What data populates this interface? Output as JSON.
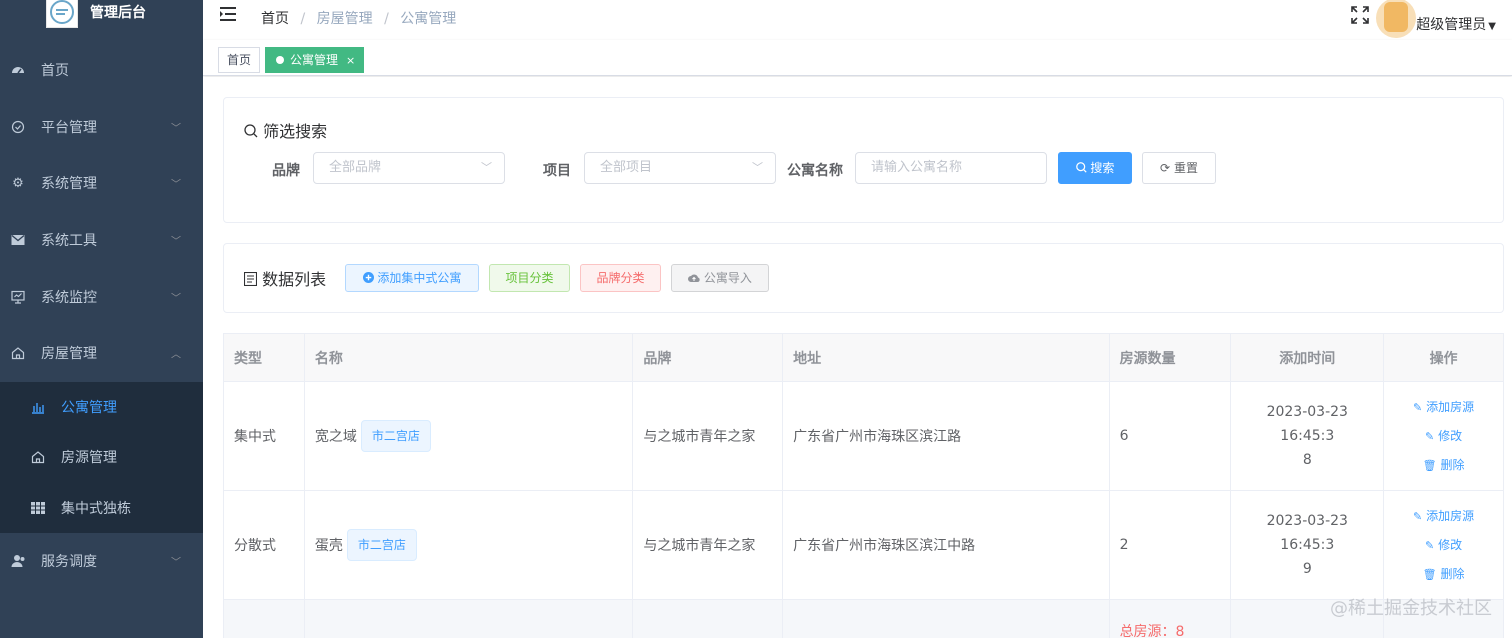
{
  "sidebar": {
    "title": "管理后台",
    "items": [
      {
        "label": "首页",
        "icon": "dashboard-icon"
      },
      {
        "label": "平台管理",
        "icon": "platform-icon"
      },
      {
        "label": "系统管理",
        "icon": "gear-icon"
      },
      {
        "label": "系统工具",
        "icon": "mail-icon"
      },
      {
        "label": "系统监控",
        "icon": "monitor-icon"
      },
      {
        "label": "房屋管理",
        "icon": "house-icon"
      },
      {
        "label": "服务调度",
        "icon": "user-icon"
      }
    ],
    "sub_items": [
      {
        "label": "公寓管理",
        "icon": "chart-icon"
      },
      {
        "label": "房源管理",
        "icon": "home-icon"
      },
      {
        "label": "集中式独栋",
        "icon": "grid-icon"
      }
    ]
  },
  "navbar": {
    "breadcrumb": [
      "首页",
      "房屋管理",
      "公寓管理"
    ],
    "separator": "/",
    "user_name": "超级管理员"
  },
  "tags": {
    "first": "首页",
    "active": "公寓管理",
    "close": "×"
  },
  "filter": {
    "title": "筛选搜索",
    "brand_label": "品牌",
    "brand_placeholder": "全部品牌",
    "project_label": "项目",
    "project_placeholder": "全部项目",
    "name_label": "公寓名称",
    "name_placeholder": "请输入公寓名称",
    "search_btn": "搜索",
    "reset_btn": "重置"
  },
  "list": {
    "title": "数据列表",
    "add_btn": "添加集中式公寓",
    "project_cat_btn": "项目分类",
    "brand_cat_btn": "品牌分类",
    "import_btn": "公寓导入"
  },
  "table": {
    "headers": [
      "类型",
      "名称",
      "品牌",
      "地址",
      "房源数量",
      "添加时间",
      "操作"
    ],
    "rows": [
      {
        "type": "集中式",
        "name": "宽之域",
        "store": "市二宫店",
        "brand": "与之城市青年之家",
        "address": "广东省广州市海珠区滨江路",
        "count": "6",
        "time_line1": "2023-03-23 16:45:3",
        "time_line2": "8"
      },
      {
        "type": "分散式",
        "name": "蛋壳",
        "store": "市二宫店",
        "brand": "与之城市青年之家",
        "address": "广东省广州市海珠区滨江中路",
        "count": "2",
        "time_line1": "2023-03-23 16:45:3",
        "time_line2": "9"
      }
    ],
    "ops": [
      "添加房源",
      "修改",
      "删除"
    ],
    "summary": "总房源：8"
  },
  "watermark": "@稀土掘金技术社区",
  "colors": {
    "sidebar_bg": "#304156",
    "accent": "#409eff",
    "tag_active": "#42b983",
    "danger": "#f56c6c"
  }
}
